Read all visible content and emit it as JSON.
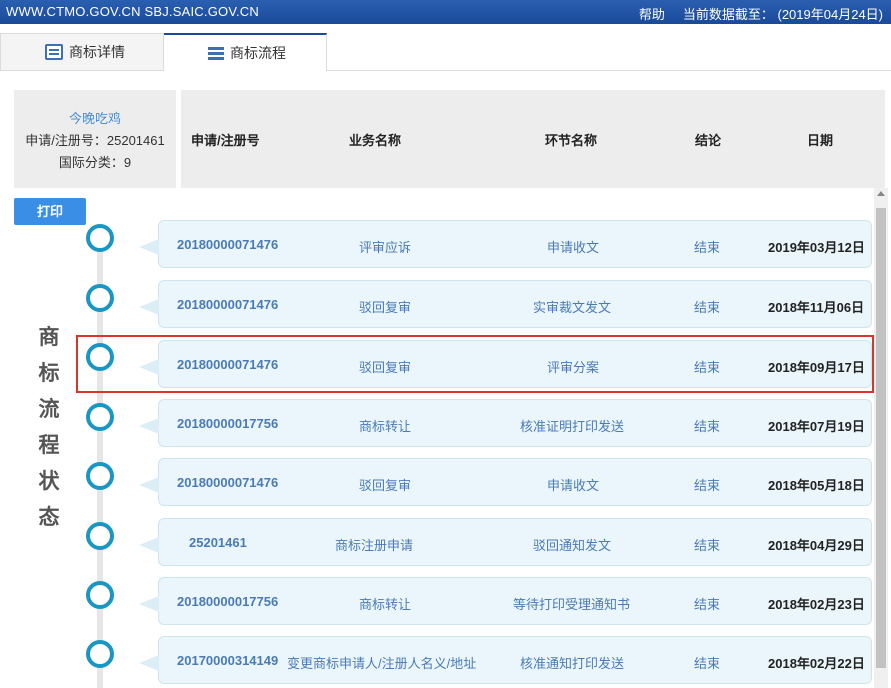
{
  "topbar": {
    "sites": "WWW.CTMO.GOV.CN  SBJ.SAIC.GOV.CN",
    "help": "帮助",
    "data_as_of_label": "当前数据截至：",
    "data_as_of_value": "(2019年04月24日)"
  },
  "tabs": [
    {
      "label": "商标详情",
      "icon": "document-icon",
      "active": false
    },
    {
      "label": "商标流程",
      "icon": "list-icon",
      "active": true
    }
  ],
  "info": {
    "name": "今晚吃鸡",
    "reg_no": "申请/注册号：25201461",
    "intl_class": "国际分类：9"
  },
  "columns": {
    "no": "申请/注册号",
    "business": "业务名称",
    "step": "环节名称",
    "result": "结论",
    "date": "日期"
  },
  "print_label": "打印",
  "side_title": [
    "商",
    "标",
    "流",
    "程",
    "状",
    "态"
  ],
  "rows": [
    {
      "no": "20180000071476",
      "business": "评审应诉",
      "step": "申请收文",
      "result": "结束",
      "date": "2019年03月12日"
    },
    {
      "no": "20180000071476",
      "business": "驳回复审",
      "step": "实审裁文发文",
      "result": "结束",
      "date": "2018年11月06日"
    },
    {
      "no": "20180000071476",
      "business": "驳回复审",
      "step": "评审分案",
      "result": "结束",
      "date": "2018年09月17日",
      "highlighted": true
    },
    {
      "no": "20180000017756",
      "business": "商标转让",
      "step": "核准证明打印发送",
      "result": "结束",
      "date": "2018年07月19日"
    },
    {
      "no": "20180000071476",
      "business": "驳回复审",
      "step": "申请收文",
      "result": "结束",
      "date": "2018年05月18日"
    },
    {
      "no": "25201461",
      "business": "商标注册申请",
      "step": "驳回通知发文",
      "result": "结束",
      "date": "2018年04月29日"
    },
    {
      "no": "20180000017756",
      "business": "商标转让",
      "step": "等待打印受理通知书",
      "result": "结束",
      "date": "2018年02月23日"
    },
    {
      "no": "20170000314149",
      "business": "变更商标申请人/注册人名义/地址",
      "step": "核准通知打印发送",
      "result": "结束",
      "date": "2018年02月22日"
    }
  ],
  "colors": {
    "topbar": "#1a4a9a",
    "accent_blue": "#3a8ee6",
    "timeline_node": "#1a96c4",
    "highlight_border": "#d9352b",
    "row_bg": "#eaf6fb"
  }
}
